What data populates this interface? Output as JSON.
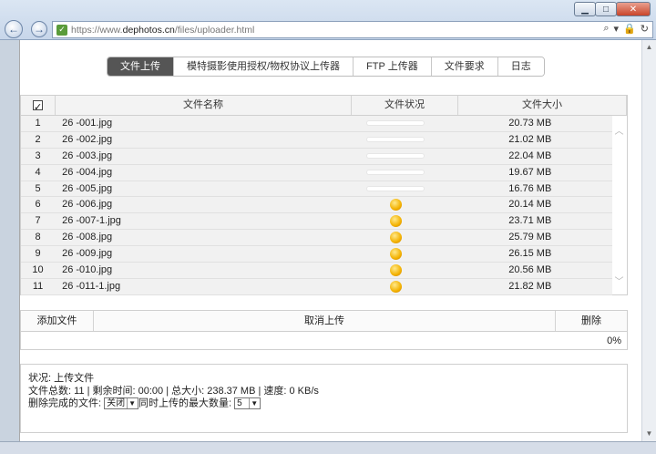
{
  "browser": {
    "url_prefix": "https://www.",
    "url_domain": "dephotos.cn",
    "url_path": "/files/uploader.html",
    "win_min": "▁",
    "win_max": "□",
    "win_close": "✕"
  },
  "tabs": [
    {
      "label": "文件上传",
      "active": true
    },
    {
      "label": "模特摄影使用授权/物权协议上传器"
    },
    {
      "label": "FTP 上传器"
    },
    {
      "label": "文件要求"
    },
    {
      "label": "日志"
    }
  ],
  "grid": {
    "headers": {
      "name": "文件名称",
      "status": "文件状况",
      "size": "文件大小"
    },
    "rows": [
      {
        "no": "1",
        "name": "26 -001.jpg",
        "status": "bar",
        "size": "20.73 MB"
      },
      {
        "no": "2",
        "name": "26 -002.jpg",
        "status": "bar",
        "size": "21.02 MB"
      },
      {
        "no": "3",
        "name": "26 -003.jpg",
        "status": "bar",
        "size": "22.04 MB"
      },
      {
        "no": "4",
        "name": "26 -004.jpg",
        "status": "bar",
        "size": "19.67 MB"
      },
      {
        "no": "5",
        "name": "26 -005.jpg",
        "status": "bar",
        "size": "16.76 MB"
      },
      {
        "no": "6",
        "name": "26 -006.jpg",
        "status": "dot",
        "size": "20.14 MB"
      },
      {
        "no": "7",
        "name": "26 -007-1.jpg",
        "status": "dot",
        "size": "23.71 MB"
      },
      {
        "no": "8",
        "name": "26 -008.jpg",
        "status": "dot",
        "size": "25.79 MB"
      },
      {
        "no": "9",
        "name": "26 -009.jpg",
        "status": "dot",
        "size": "26.15 MB"
      },
      {
        "no": "10",
        "name": "26 -010.jpg",
        "status": "dot",
        "size": "20.56 MB"
      },
      {
        "no": "11",
        "name": "26 -011-1.jpg",
        "status": "dot",
        "size": "21.82 MB"
      }
    ]
  },
  "actions": {
    "add": "添加文件",
    "cancel": "取消上传",
    "delete": "删除"
  },
  "progress": "0%",
  "status": {
    "line1": "状况: 上传文件",
    "line2": "文件总数: 11 | 剩余时间: 00:00 | 总大小: 238.37 MB | 速度: 0 KB/s",
    "delete_label": "删除完成的文件:",
    "delete_value": "关闭",
    "max_label": "同时上传的最大数量:",
    "max_value": "5"
  },
  "colors": {
    "status_dot": "#f3b100",
    "active_tab": "#555555"
  }
}
